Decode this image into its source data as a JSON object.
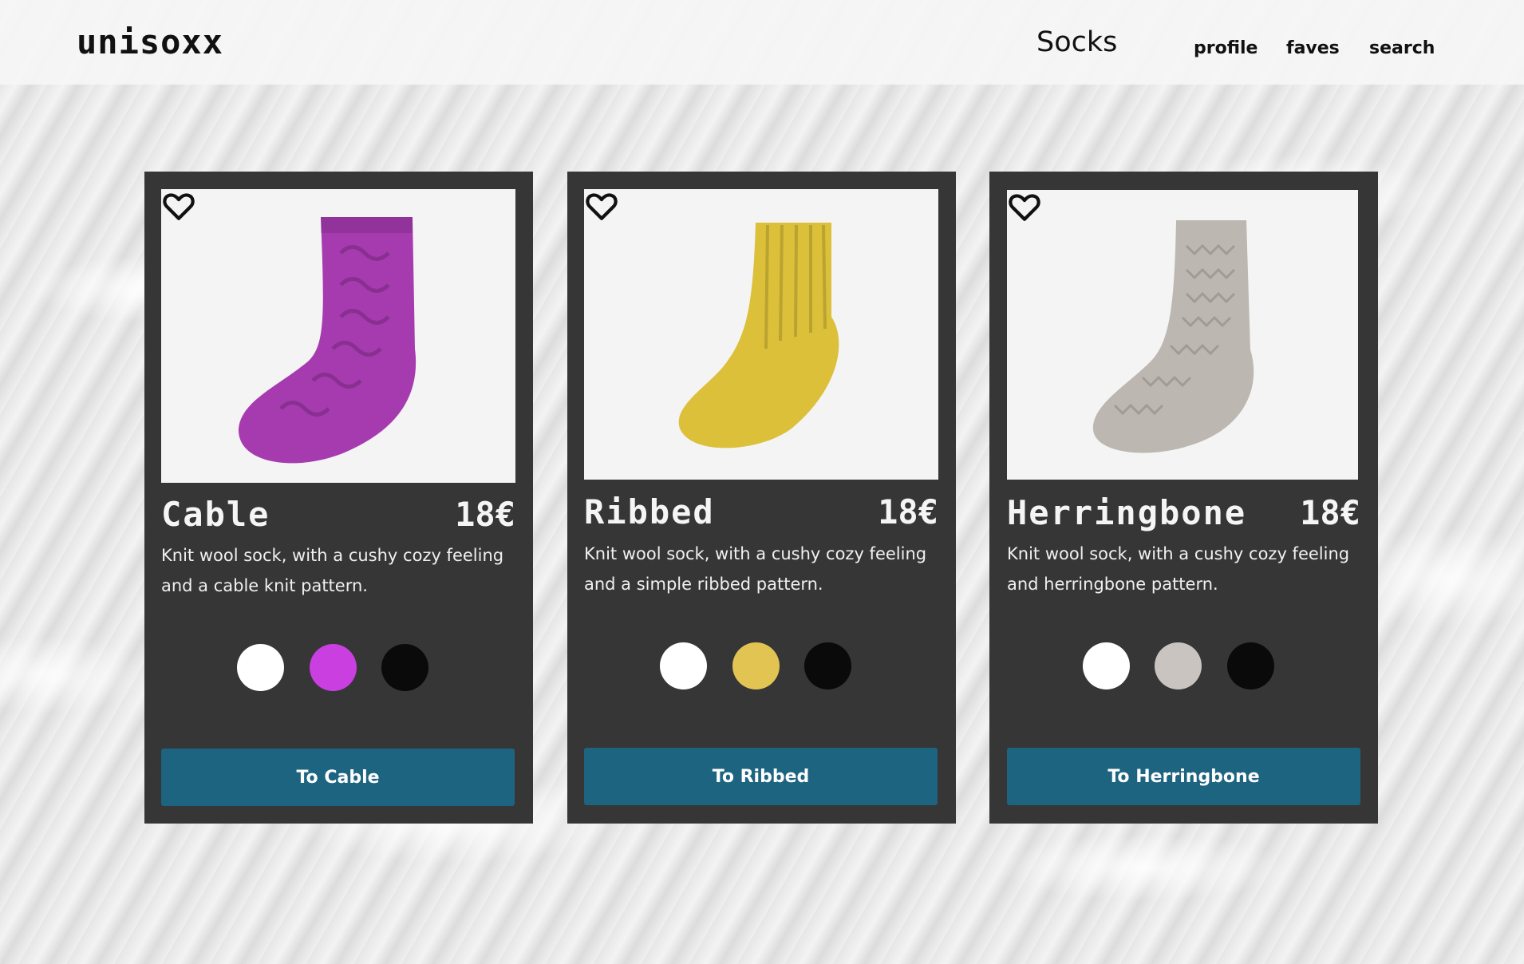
{
  "header": {
    "logo": "unisoxx",
    "title": "Socks",
    "nav": [
      {
        "label": "profile"
      },
      {
        "label": "faves"
      },
      {
        "label": "search"
      }
    ]
  },
  "products": [
    {
      "name": "Cable",
      "price": "18€",
      "description": "Knit wool sock, with a cushy cozy feeling and a cable knit pattern.",
      "sock_color": "#a63bb0",
      "swatches": [
        "#ffffff",
        "#c93fe0",
        "#0a0a0a"
      ],
      "button_label": "To Cable",
      "favorite_icon": "heart-outline-icon"
    },
    {
      "name": "Ribbed",
      "price": "18€",
      "description": "Knit wool sock, with a cushy cozy feeling and a simple ribbed pattern.",
      "sock_color": "#dcc03a",
      "swatches": [
        "#ffffff",
        "#e2c452",
        "#0a0a0a"
      ],
      "button_label": "To Ribbed",
      "favorite_icon": "heart-outline-icon"
    },
    {
      "name": "Herringbone",
      "price": "18€",
      "description": "Knit wool sock, with a cushy cozy feeling and herringbone pattern.",
      "sock_color": "#bdb7b1",
      "swatches": [
        "#ffffff",
        "#c9c4bf",
        "#0a0a0a"
      ],
      "button_label": "To Herringbone",
      "favorite_icon": "heart-outline-icon"
    }
  ],
  "colors": {
    "card_bg": "#363636",
    "button_bg": "#1d6480",
    "header_bg": "#f5f5f5"
  }
}
